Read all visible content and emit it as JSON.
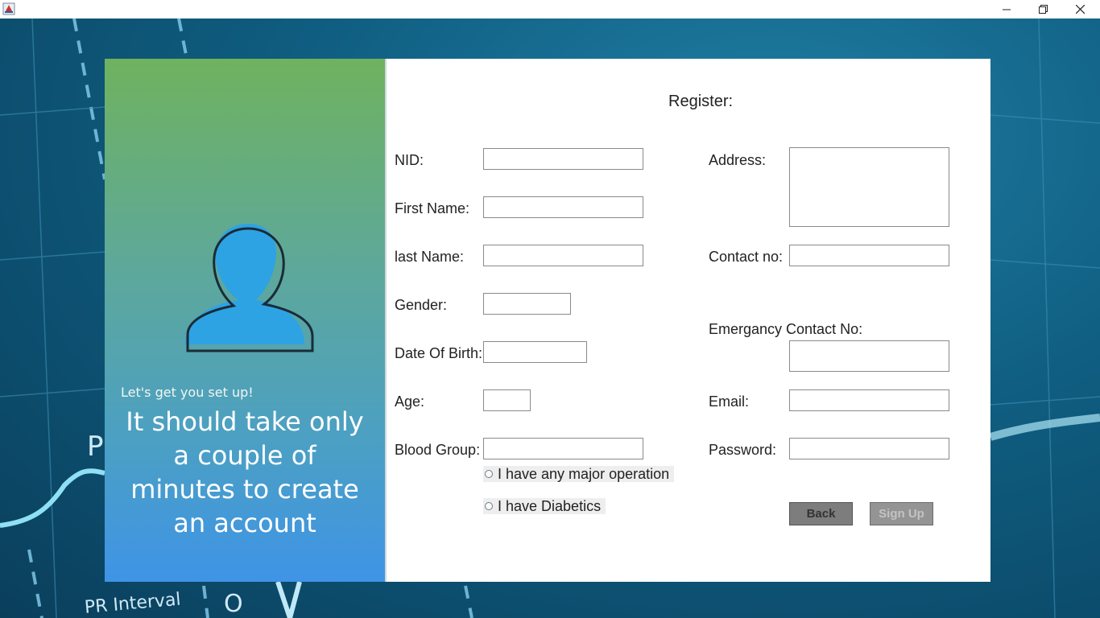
{
  "window": {
    "title": "",
    "controls": {
      "minimize": "minimize-icon",
      "maximize": "restore-icon",
      "close": "close-icon"
    }
  },
  "background": {
    "letter_p": "P",
    "ecg_label": "PR Interval",
    "letter_o": "O"
  },
  "left_panel": {
    "subtitle": "Let's get you set up!",
    "headline_lines": [
      "It should take only",
      "a couple of",
      "minutes to create",
      "an account"
    ]
  },
  "form": {
    "title": "Register:",
    "nid": {
      "label": "NID:",
      "value": ""
    },
    "first_name": {
      "label": "First Name:",
      "value": ""
    },
    "last_name": {
      "label": "last Name:",
      "value": ""
    },
    "gender": {
      "label": "Gender:",
      "value": ""
    },
    "dob": {
      "label": "Date Of Birth:",
      "value": ""
    },
    "age": {
      "label": "Age:",
      "value": ""
    },
    "blood_group": {
      "label": "Blood Group:",
      "value": ""
    },
    "address": {
      "label": "Address:",
      "value": ""
    },
    "contact": {
      "label": "Contact no:",
      "value": ""
    },
    "emergency": {
      "label": "Emergancy Contact No:",
      "value": ""
    },
    "email": {
      "label": "Email:",
      "value": ""
    },
    "password": {
      "label": "Password:",
      "value": ""
    },
    "major_operation": {
      "label": "I have any major operation",
      "checked": false
    },
    "diabetics": {
      "label": "I have Diabetics",
      "checked": false
    },
    "back_button": "Back",
    "signup_button": "Sign Up"
  },
  "colors": {
    "panel_top": "#6fb25f",
    "panel_bottom": "#3f94e6",
    "button": "#7d7d7d",
    "avatar_fill": "#2ea3e3"
  }
}
